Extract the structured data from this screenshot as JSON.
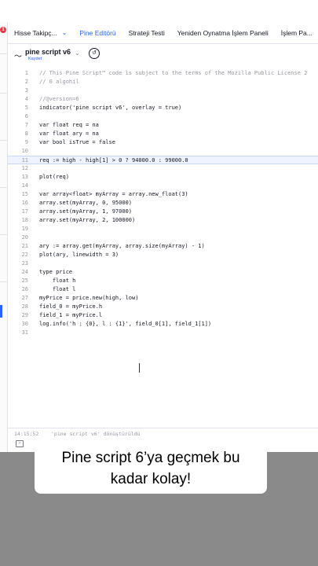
{
  "tabs": [
    {
      "label": "Hisse Takipç...",
      "chevron": "⌄"
    },
    {
      "label": "Pine Editörü"
    },
    {
      "label": "Strateji Testi"
    },
    {
      "label": "Yeniden Oynatma İşlem Paneli"
    },
    {
      "label": "İşlem Pa..."
    }
  ],
  "header": {
    "icon": "〜",
    "title": "pine script v6",
    "subtitle": "Kaydet",
    "chevron": "⌄",
    "history_icon": "↺"
  },
  "notification_count": "1",
  "colors": {
    "accent": "#2962ff",
    "keyword": "#2962ff",
    "number": "#e0457b",
    "string": "#22ab94",
    "comment": "#9598a1",
    "type": "#131722"
  },
  "code_lines": [
    {
      "n": "1",
      "text": "// This Pine Script™ code is subject to the terms of the Mozilla Public License 2"
    },
    {
      "n": "2",
      "text": "// 0 algohil"
    },
    {
      "n": "3",
      "text": ""
    },
    {
      "n": "4",
      "text": "//@version=6"
    },
    {
      "n": "5",
      "text": "indicator('pine script v6', overlay = true)"
    },
    {
      "n": "6",
      "text": ""
    },
    {
      "n": "7",
      "text": "var float req = na"
    },
    {
      "n": "8",
      "text": "var float ary = na"
    },
    {
      "n": "9",
      "text": "var bool isTrue = false"
    },
    {
      "n": "10",
      "text": ""
    },
    {
      "n": "11",
      "text": "req := high - high[1] > 0 ? 94000.0 : 99000.0"
    },
    {
      "n": "12",
      "text": ""
    },
    {
      "n": "13",
      "text": "plot(req)"
    },
    {
      "n": "14",
      "text": ""
    },
    {
      "n": "15",
      "text": "var array<float> myArray = array.new_float(3)"
    },
    {
      "n": "16",
      "text": "array.set(myArray, 0, 95000)"
    },
    {
      "n": "17",
      "text": "array.set(myArray, 1, 97000)"
    },
    {
      "n": "18",
      "text": "array.set(myArray, 2, 100000)"
    },
    {
      "n": "19",
      "text": ""
    },
    {
      "n": "20",
      "text": ""
    },
    {
      "n": "21",
      "text": "ary := array.get(myArray, array.size(myArray) - 1)"
    },
    {
      "n": "22",
      "text": "plot(ary, linewidth = 3)"
    },
    {
      "n": "23",
      "text": ""
    },
    {
      "n": "24",
      "text": "type price"
    },
    {
      "n": "25",
      "text": "    float h"
    },
    {
      "n": "26",
      "text": "    float l"
    },
    {
      "n": "27",
      "text": "myPrice = price.new(high, low)"
    },
    {
      "n": "28",
      "text": "field_0 = myPrice.h"
    },
    {
      "n": "29",
      "text": "field_1 = myPrice.l"
    },
    {
      "n": "30",
      "text": "log.info('h : {0}, l : {1}', field_0[1], field_1[1])"
    },
    {
      "n": "31",
      "text": ""
    }
  ],
  "status": {
    "time": "14:15:52",
    "message": "'pine script v6' dönüştürüldü"
  },
  "caption": {
    "line1": "Pine script 6’ya geçmek bu",
    "line2": "kadar kolay!"
  }
}
